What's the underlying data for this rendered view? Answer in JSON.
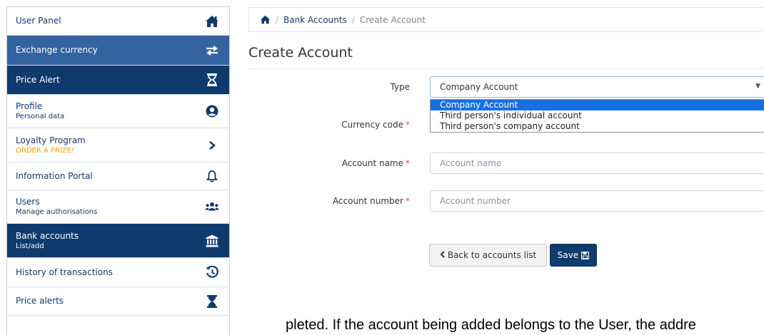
{
  "sidebar": {
    "items": [
      {
        "label": "User Panel",
        "sub": "",
        "icon": "home-icon"
      },
      {
        "label": "Exchange currency",
        "sub": "",
        "icon": "exchange-arrows-icon"
      },
      {
        "label": "Price Alert",
        "sub": "",
        "icon": "hourglass-icon"
      },
      {
        "label": "Profile",
        "sub": "Personal data",
        "icon": "user-circle-icon"
      },
      {
        "label": "Loyalty Program",
        "sub": "ORDER A PRIZE!",
        "icon": "chevron-right-icon"
      },
      {
        "label": "Information Portal",
        "sub": "",
        "icon": "bell-icon"
      },
      {
        "label": "Users",
        "sub": "Manage authorisations",
        "icon": "users-icon"
      },
      {
        "label": "Bank accounts",
        "sub": "List/add",
        "icon": "bank-icon"
      },
      {
        "label": "History of transactions",
        "sub": "",
        "icon": "history-icon"
      },
      {
        "label": "Price alerts",
        "sub": "",
        "icon": "hourglass-icon"
      }
    ]
  },
  "breadcrumb": {
    "home_icon": "home-icon",
    "sep": "/",
    "link": "Bank Accounts",
    "current": "Create Account"
  },
  "page": {
    "title": "Create Account"
  },
  "form": {
    "type_label": "Type",
    "type_value": "Company Account",
    "type_options": [
      "Company Account",
      "Third person's individual account",
      "Third person's company account"
    ],
    "currency_label": "Currency code",
    "account_name_label": "Account name",
    "account_name_placeholder": "Account name",
    "account_number_label": "Account number",
    "account_number_placeholder": "Account number",
    "required_mark": "*"
  },
  "buttons": {
    "back": "Back to accounts list",
    "save": "Save"
  },
  "bottom_text": "pleted. If the account being added belongs to the User, the addre",
  "colors": {
    "navy": "#0f3a6d",
    "medium_blue": "#3463a1",
    "orange": "#f3a100",
    "selected_option": "#1a6fe0"
  }
}
